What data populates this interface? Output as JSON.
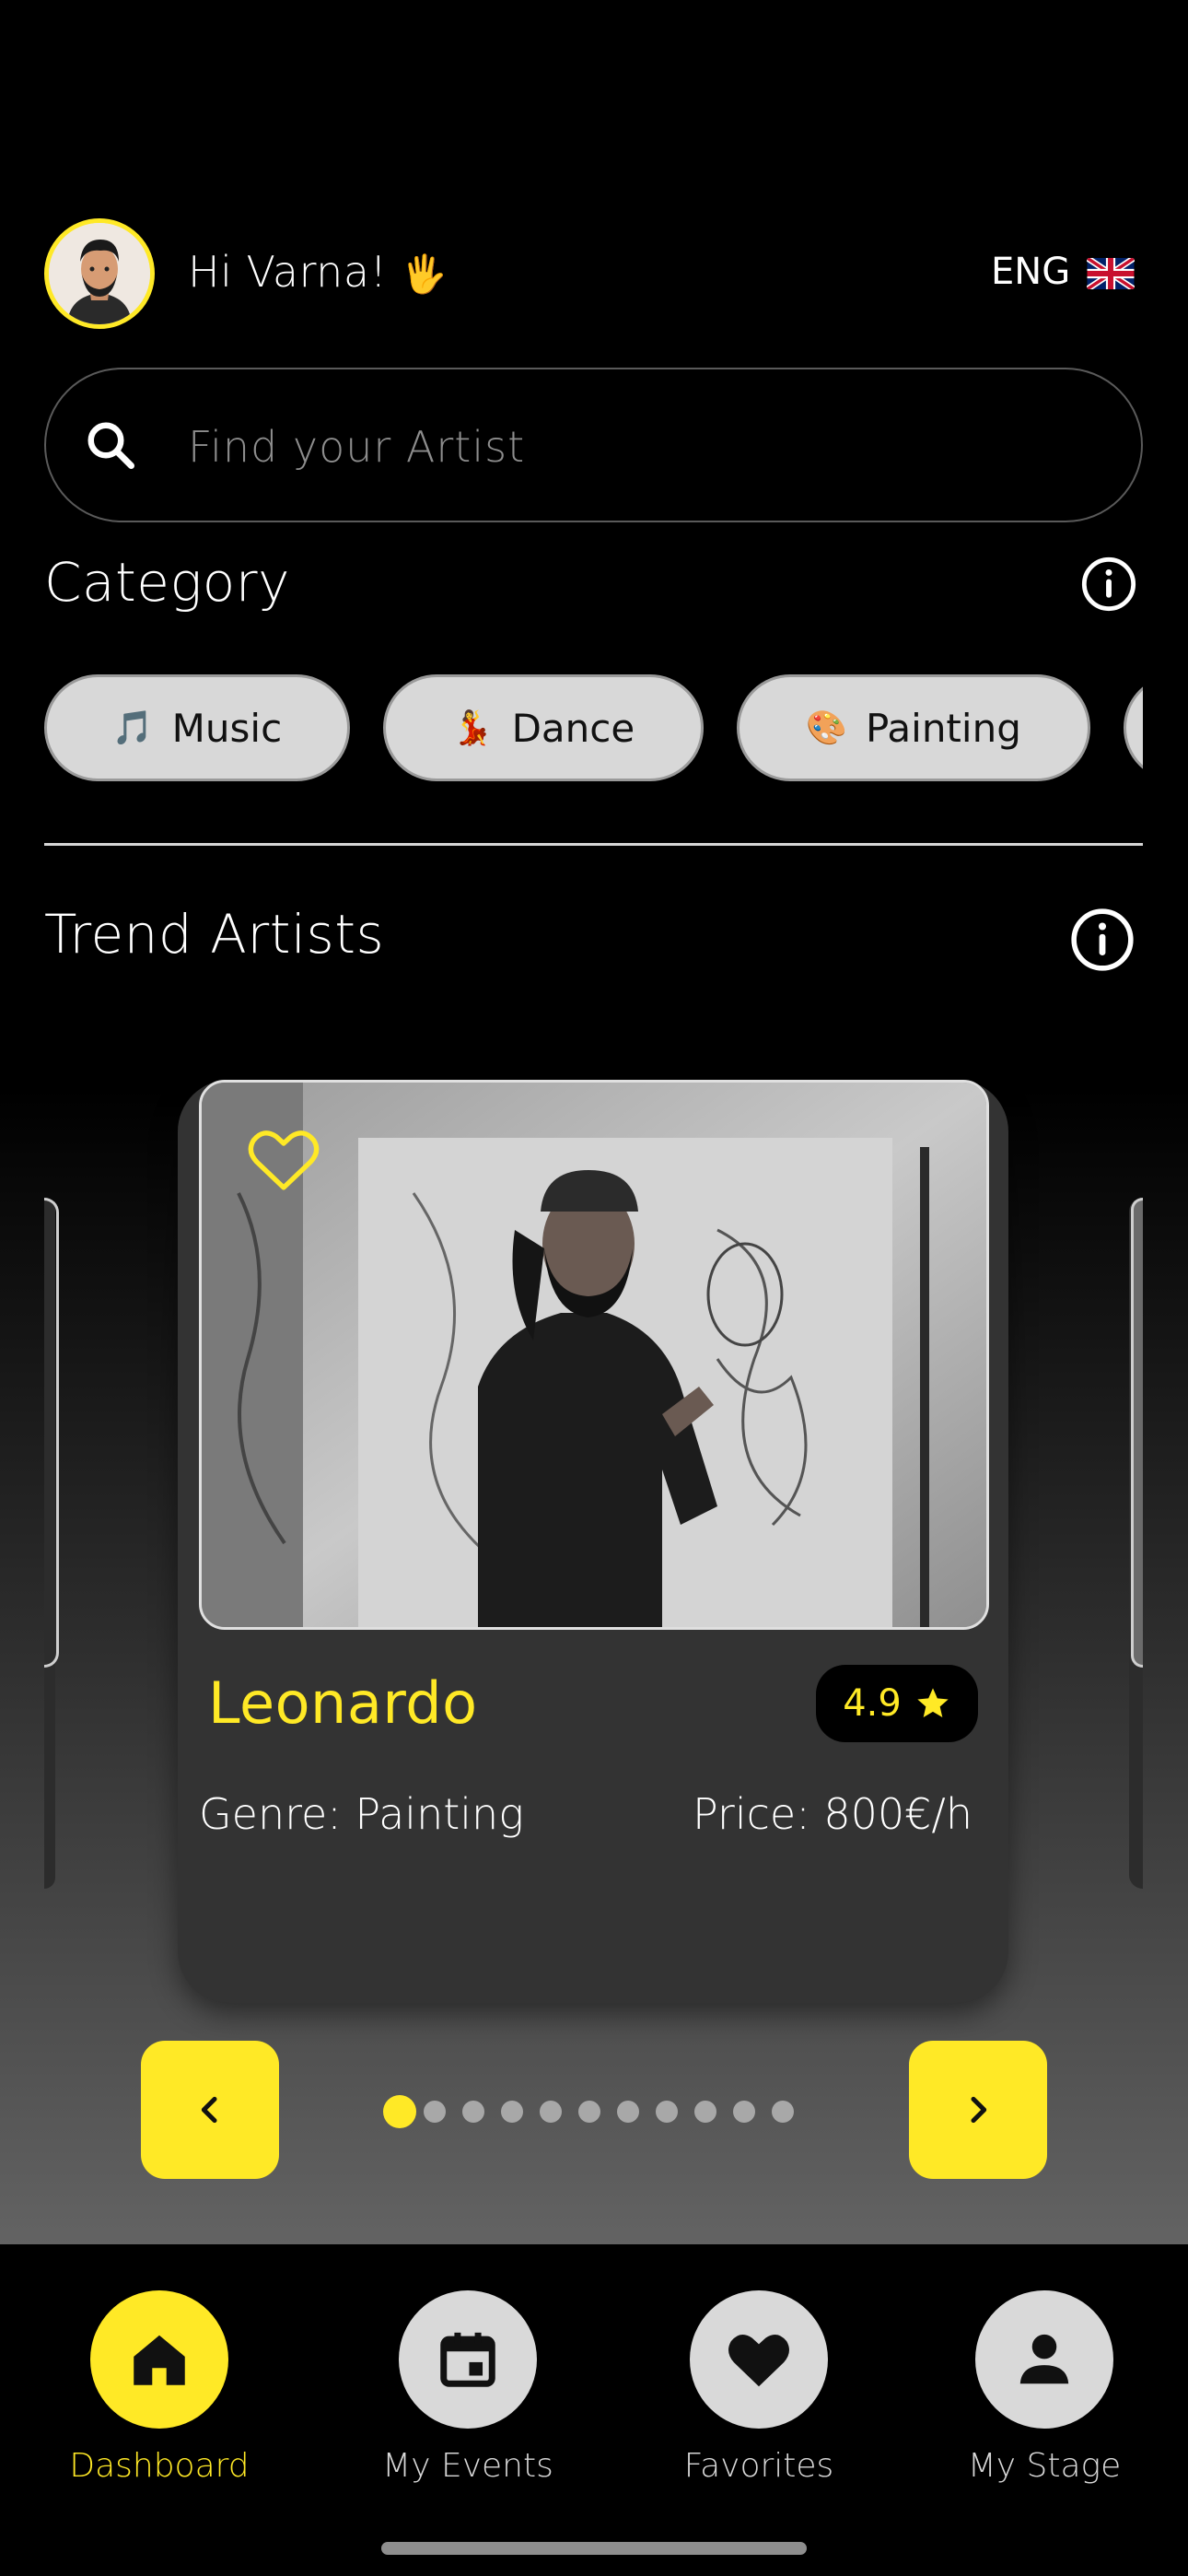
{
  "header": {
    "greeting": "Hi Varna!",
    "greeting_emoji": "🖐",
    "language": "ENG",
    "flag_icon": "uk-flag-icon"
  },
  "search": {
    "placeholder": "Find your Artist",
    "icon": "search-icon"
  },
  "category": {
    "title": "Category",
    "items": [
      {
        "label": "Music",
        "icon": "🎵"
      },
      {
        "label": "Dance",
        "icon": "💃"
      },
      {
        "label": "Painting",
        "icon": "🎨"
      }
    ]
  },
  "trend": {
    "title": "Trend Artists",
    "card": {
      "name": "Leonardo",
      "rating": "4.9",
      "genre": "Genre: Painting",
      "price": "Price: 800€/h",
      "favorite_icon": "heart-outline-icon"
    },
    "pager": {
      "total": 11,
      "active": 0
    }
  },
  "bottom_nav": {
    "items": [
      {
        "label": "Dashboard",
        "icon": "home-icon",
        "active": true
      },
      {
        "label": "My Events",
        "icon": "calendar-icon",
        "active": false
      },
      {
        "label": "Favorites",
        "icon": "heart-icon",
        "active": false
      },
      {
        "label": "My Stage",
        "icon": "person-icon",
        "active": false
      }
    ]
  },
  "colors": {
    "accent": "#ffe926",
    "background": "#000000",
    "card": "#333333",
    "chip": "#d8d8d8"
  }
}
